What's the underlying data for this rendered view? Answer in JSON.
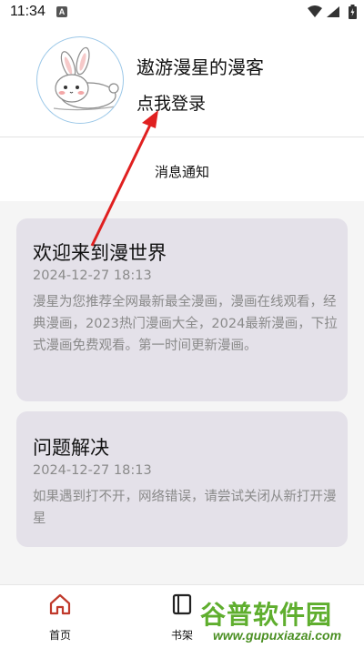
{
  "status_bar": {
    "time": "11:34",
    "notification_badge": "A",
    "icons": [
      "wifi-icon",
      "signal-icon",
      "battery-icon"
    ]
  },
  "profile": {
    "username": "遨游漫星的漫客",
    "login_prompt": "点我登录",
    "avatar_icon": "bunny-avatar-icon"
  },
  "messages": {
    "section_title": "消息通知",
    "items": [
      {
        "title": "欢迎来到漫世界",
        "date": "2024-12-27 18:13",
        "body": "漫星为您推荐全网最新最全漫画，漫画在线观看，经典漫画，2023热门漫画大全，2024最新漫画，下拉式漫画免费观看。第一时间更新漫画。"
      },
      {
        "title": "问题解决",
        "date": "2024-12-27 18:13",
        "body": "如果遇到打不开，网络错误，请尝试关闭从新打开漫星"
      }
    ]
  },
  "bottom_nav": {
    "items": [
      {
        "label": "首页",
        "icon": "home-icon"
      },
      {
        "label": "书架",
        "icon": "bookshelf-icon"
      }
    ]
  },
  "watermark": {
    "main": "谷普软件园",
    "url": "www.gupuxiazai.com"
  },
  "colors": {
    "card_bg": "#e4e1e9",
    "annotation_arrow": "#e02020",
    "watermark": "#5fae2e"
  }
}
